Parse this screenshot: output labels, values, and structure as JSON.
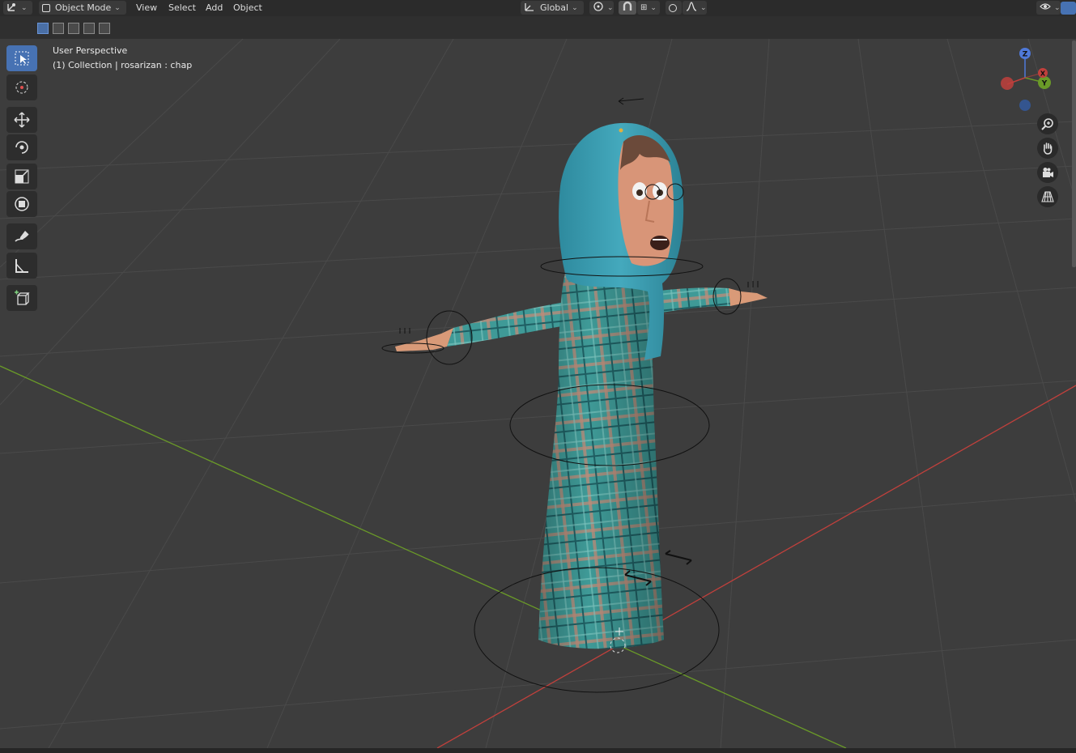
{
  "header": {
    "editor_type_icon": "grid-axes-icon",
    "mode_label": "Object Mode",
    "menu": [
      "View",
      "Select",
      "Add",
      "Object"
    ],
    "orientation_label": "Global",
    "pivot_icon": "pivot-icon",
    "snap_icon": "snap-magnet-icon",
    "proportional_icon": "proportional-edit-icon",
    "visibility_icon": "eye-icon"
  },
  "viewport": {
    "view_name": "User Perspective",
    "collection_line": "(1) Collection | rosarizan : chap"
  },
  "gizmo": {
    "z": "Z",
    "y": "Y",
    "x": "X"
  },
  "toolbar": {
    "tools": [
      "select-box-icon",
      "cursor-icon",
      "move-icon",
      "rotate-icon",
      "scale-icon",
      "transform-icon",
      "annotate-icon",
      "measure-icon",
      "add-cube-icon"
    ],
    "active": "select-box-icon"
  },
  "nav_buttons": [
    "zoom-icon",
    "hand-pan-icon",
    "camera-icon",
    "perspective-grid-icon"
  ],
  "colors": {
    "accent": "#4772b3",
    "x_axis": "#c0403c",
    "y_axis": "#6a9a28",
    "background": "#3d3d3d"
  }
}
